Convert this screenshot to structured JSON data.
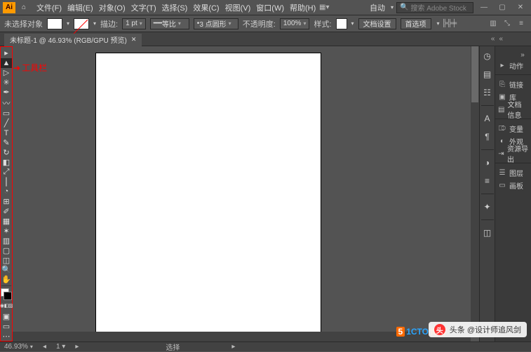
{
  "app": {
    "badge": "Ai"
  },
  "menu": {
    "items": [
      "文件(F)",
      "编辑(E)",
      "对象(O)",
      "文字(T)",
      "选择(S)",
      "效果(C)",
      "视图(V)",
      "窗口(W)",
      "帮助(H)"
    ],
    "auto_label": "自动",
    "search_placeholder": "搜索 Adobe Stock"
  },
  "ctrl": {
    "noselect": "未选择对象",
    "stroke_label": "描边:",
    "stroke_pt": "1 pt",
    "uniform": "等比",
    "round": "3 点圆形",
    "opacity_label": "不透明度:",
    "opacity_val": "100%",
    "style_label": "样式:",
    "docsetup": "文档设置",
    "prefs": "首选项"
  },
  "tab": {
    "title": "未标题-1 @ 46.93% (RGB/GPU 预览)"
  },
  "annotation": {
    "arrow": "➔",
    "text": "工具栏"
  },
  "tools": [
    {
      "n": "triangle-icon",
      "g": "▸"
    },
    {
      "n": "selection-tool-icon",
      "g": "▲"
    },
    {
      "n": "direct-select-tool-icon",
      "g": "▷"
    },
    {
      "n": "magic-wand-tool-icon",
      "g": "✳"
    },
    {
      "n": "pen-tool-icon",
      "g": "✒"
    },
    {
      "n": "curvature-tool-icon",
      "g": "〰"
    },
    {
      "n": "rectangle-tool-icon",
      "g": "▭"
    },
    {
      "n": "line-tool-icon",
      "g": "╱"
    },
    {
      "n": "type-tool-icon",
      "g": "T"
    },
    {
      "n": "paintbrush-tool-icon",
      "g": "✎"
    },
    {
      "n": "rotate-tool-icon",
      "g": "↻"
    },
    {
      "n": "eraser-tool-icon",
      "g": "◧"
    },
    {
      "n": "scale-tool-icon",
      "g": "⤢"
    },
    {
      "n": "width-tool-icon",
      "g": "⎮"
    },
    {
      "n": "shape-builder-icon",
      "g": "◔"
    },
    {
      "n": "free-transform-icon",
      "g": "⊞"
    },
    {
      "n": "eyedropper-tool-icon",
      "g": "✐"
    },
    {
      "n": "gradient-tool-icon",
      "g": "▦"
    },
    {
      "n": "symbol-spray-icon",
      "g": "✶"
    },
    {
      "n": "graph-tool-icon",
      "g": "▥"
    },
    {
      "n": "artboard-tool-icon",
      "g": "▢"
    },
    {
      "n": "slice-tool-icon",
      "g": "◫"
    },
    {
      "n": "zoom-tool-icon",
      "g": "🔍"
    },
    {
      "n": "hand-tool-icon",
      "g": "✋"
    }
  ],
  "modes": [
    {
      "n": "color-mode-icon",
      "g": "◉"
    },
    {
      "n": "gradient-mode-icon",
      "g": "◧"
    },
    {
      "n": "none-mode-icon",
      "g": "▨"
    }
  ],
  "screenmodes": [
    {
      "n": "draw-normal-icon",
      "g": "▣"
    },
    {
      "n": "screen-mode-icon",
      "g": "▭"
    },
    {
      "n": "more-tools-icon",
      "g": "⋯"
    }
  ],
  "dock": [
    {
      "n": "properties-dock-icon",
      "g": "◷"
    },
    {
      "n": "libraries-dock-icon",
      "g": "▤"
    },
    {
      "n": "layers-dock-icon",
      "g": "☷"
    },
    {
      "n": "sep"
    },
    {
      "n": "character-dock-icon",
      "g": "A"
    },
    {
      "n": "paragraph-dock-icon",
      "g": "¶"
    },
    {
      "n": "sep"
    },
    {
      "n": "appearance-dock-icon",
      "g": "◑"
    },
    {
      "n": "graphic-styles-dock-icon",
      "g": "≡"
    },
    {
      "n": "sep"
    },
    {
      "n": "symbols-dock-icon",
      "g": "✦"
    },
    {
      "n": "sep"
    },
    {
      "n": "brushes-dock-icon",
      "g": "◫"
    }
  ],
  "panel": {
    "rows1": [
      {
        "n": "actions-panel",
        "i": "▸",
        "t": "动作"
      }
    ],
    "rows2": [
      {
        "n": "links-panel",
        "i": "⎘",
        "t": "链接"
      },
      {
        "n": "libraries-panel",
        "i": "▣",
        "t": "库"
      },
      {
        "n": "docinfo-panel",
        "i": "▤",
        "t": "文档信息"
      }
    ],
    "rows3": [
      {
        "n": "variables-panel",
        "i": "⎄",
        "t": "变量"
      },
      {
        "n": "appearance-panel",
        "i": "◐",
        "t": "外观"
      },
      {
        "n": "asset-export-panel",
        "i": "⇥",
        "t": "资源导出"
      }
    ],
    "rows4": [
      {
        "n": "layers-panel",
        "i": "☰",
        "t": "图层"
      },
      {
        "n": "artboards-panel",
        "i": "▭",
        "t": "画板"
      }
    ]
  },
  "status": {
    "zoom": "46.93%",
    "sel": "选择"
  },
  "wm": {
    "toutiao_prefix": "头条",
    "toutiao": "@设计师追风剑",
    "site": "51CTO博客"
  }
}
